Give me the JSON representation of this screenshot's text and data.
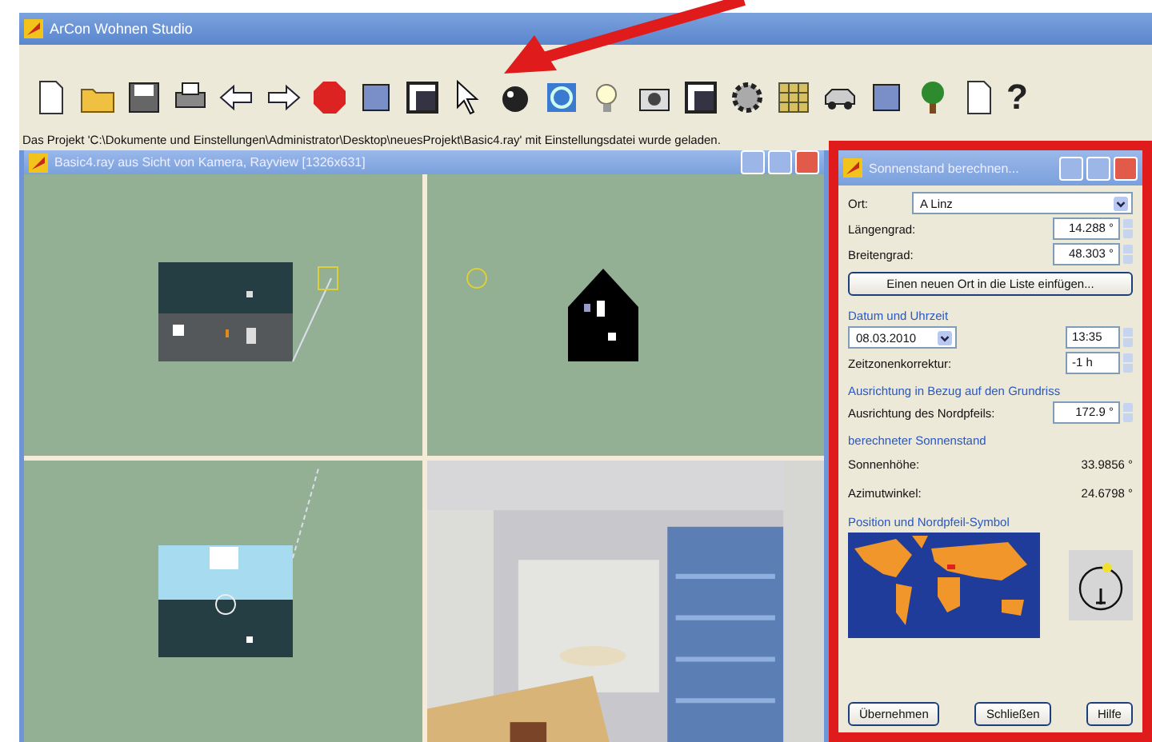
{
  "app": {
    "title": "ArCon Wohnen Studio"
  },
  "toolbar": {
    "help_label": "?"
  },
  "status_bar": "Das Projekt 'C:\\Dokumente und Einstellungen\\Administrator\\Desktop\\neuesProjekt\\Basic4.ray' mit Einstellungsdatei wurde geladen.",
  "viewer": {
    "title": "Basic4.ray aus Sicht von Kamera, Rayview [1326x631]"
  },
  "dialog": {
    "title": "Sonnenstand berechnen...",
    "location": {
      "label": "Ort:",
      "value": "A Linz"
    },
    "longitude": {
      "label": "Längengrad:",
      "value": "14.288 °"
    },
    "latitude": {
      "label": "Breitengrad:",
      "value": "48.303 °"
    },
    "add_button": "Einen neuen Ort in die Liste einfügen...",
    "datetime": {
      "heading": "Datum und Uhrzeit",
      "date": "08.03.2010",
      "time": "13:35",
      "tz_label": "Zeitzonenkorrektur:",
      "tz_value": "-1 h"
    },
    "orientation": {
      "heading": "Ausrichtung in Bezug auf den Grundriss",
      "label": "Ausrichtung des Nordpfeils:",
      "value": "172.9 °"
    },
    "sun": {
      "heading": "berechneter Sonnenstand",
      "rows": [
        {
          "label": "Sonnenhöhe:",
          "value": "33.9856 °"
        },
        {
          "label": "Azimutwinkel:",
          "value": "24.6798 °"
        }
      ]
    },
    "symbol_heading": "Position und Nordpfeil-Symbol",
    "buttons": [
      "Übernehmen",
      "Schließen",
      "Hilfe"
    ]
  }
}
